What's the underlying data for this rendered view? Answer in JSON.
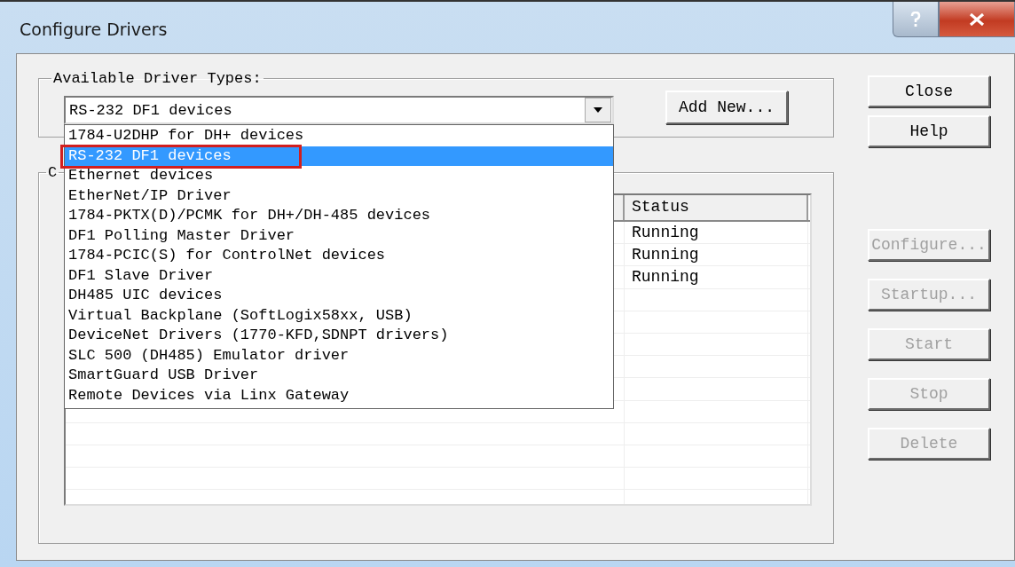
{
  "window": {
    "title": "Configure Drivers"
  },
  "driver_types": {
    "label": "Available Driver Types:",
    "value": "RS-232 DF1 devices",
    "expanded": true,
    "options": [
      {
        "label": "1784-U2DHP for DH+ devices",
        "selected": false
      },
      {
        "label": "RS-232 DF1 devices",
        "selected": true
      },
      {
        "label": "Ethernet devices",
        "selected": false
      },
      {
        "label": "EtherNet/IP Driver",
        "selected": false
      },
      {
        "label": "1784-PKTX(D)/PCMK for DH+/DH-485 devices",
        "selected": false
      },
      {
        "label": "DF1 Polling Master Driver",
        "selected": false
      },
      {
        "label": "1784-PCIC(S) for ControlNet devices",
        "selected": false
      },
      {
        "label": "DF1 Slave Driver",
        "selected": false
      },
      {
        "label": "DH485 UIC devices",
        "selected": false
      },
      {
        "label": "Virtual Backplane (SoftLogix58xx, USB)",
        "selected": false
      },
      {
        "label": "DeviceNet Drivers (1770-KFD,SDNPT drivers)",
        "selected": false
      },
      {
        "label": "SLC 500 (DH485) Emulator driver",
        "selected": false
      },
      {
        "label": "SmartGuard USB Driver",
        "selected": false
      },
      {
        "label": "Remote Devices via Linx Gateway",
        "selected": false
      }
    ]
  },
  "add_new_button": "Add New...",
  "configured_drivers": {
    "label": "C",
    "status_column": "Status",
    "rows": [
      {
        "status": "Running"
      },
      {
        "status": "Running"
      },
      {
        "status": "Running"
      }
    ]
  },
  "buttons": [
    {
      "label": "Close",
      "disabled": false
    },
    {
      "label": "Help",
      "disabled": false
    },
    {
      "label": "Configure...",
      "disabled": true
    },
    {
      "label": "Startup...",
      "disabled": true
    },
    {
      "label": "Start",
      "disabled": true
    },
    {
      "label": "Stop",
      "disabled": true
    },
    {
      "label": "Delete",
      "disabled": true
    }
  ]
}
